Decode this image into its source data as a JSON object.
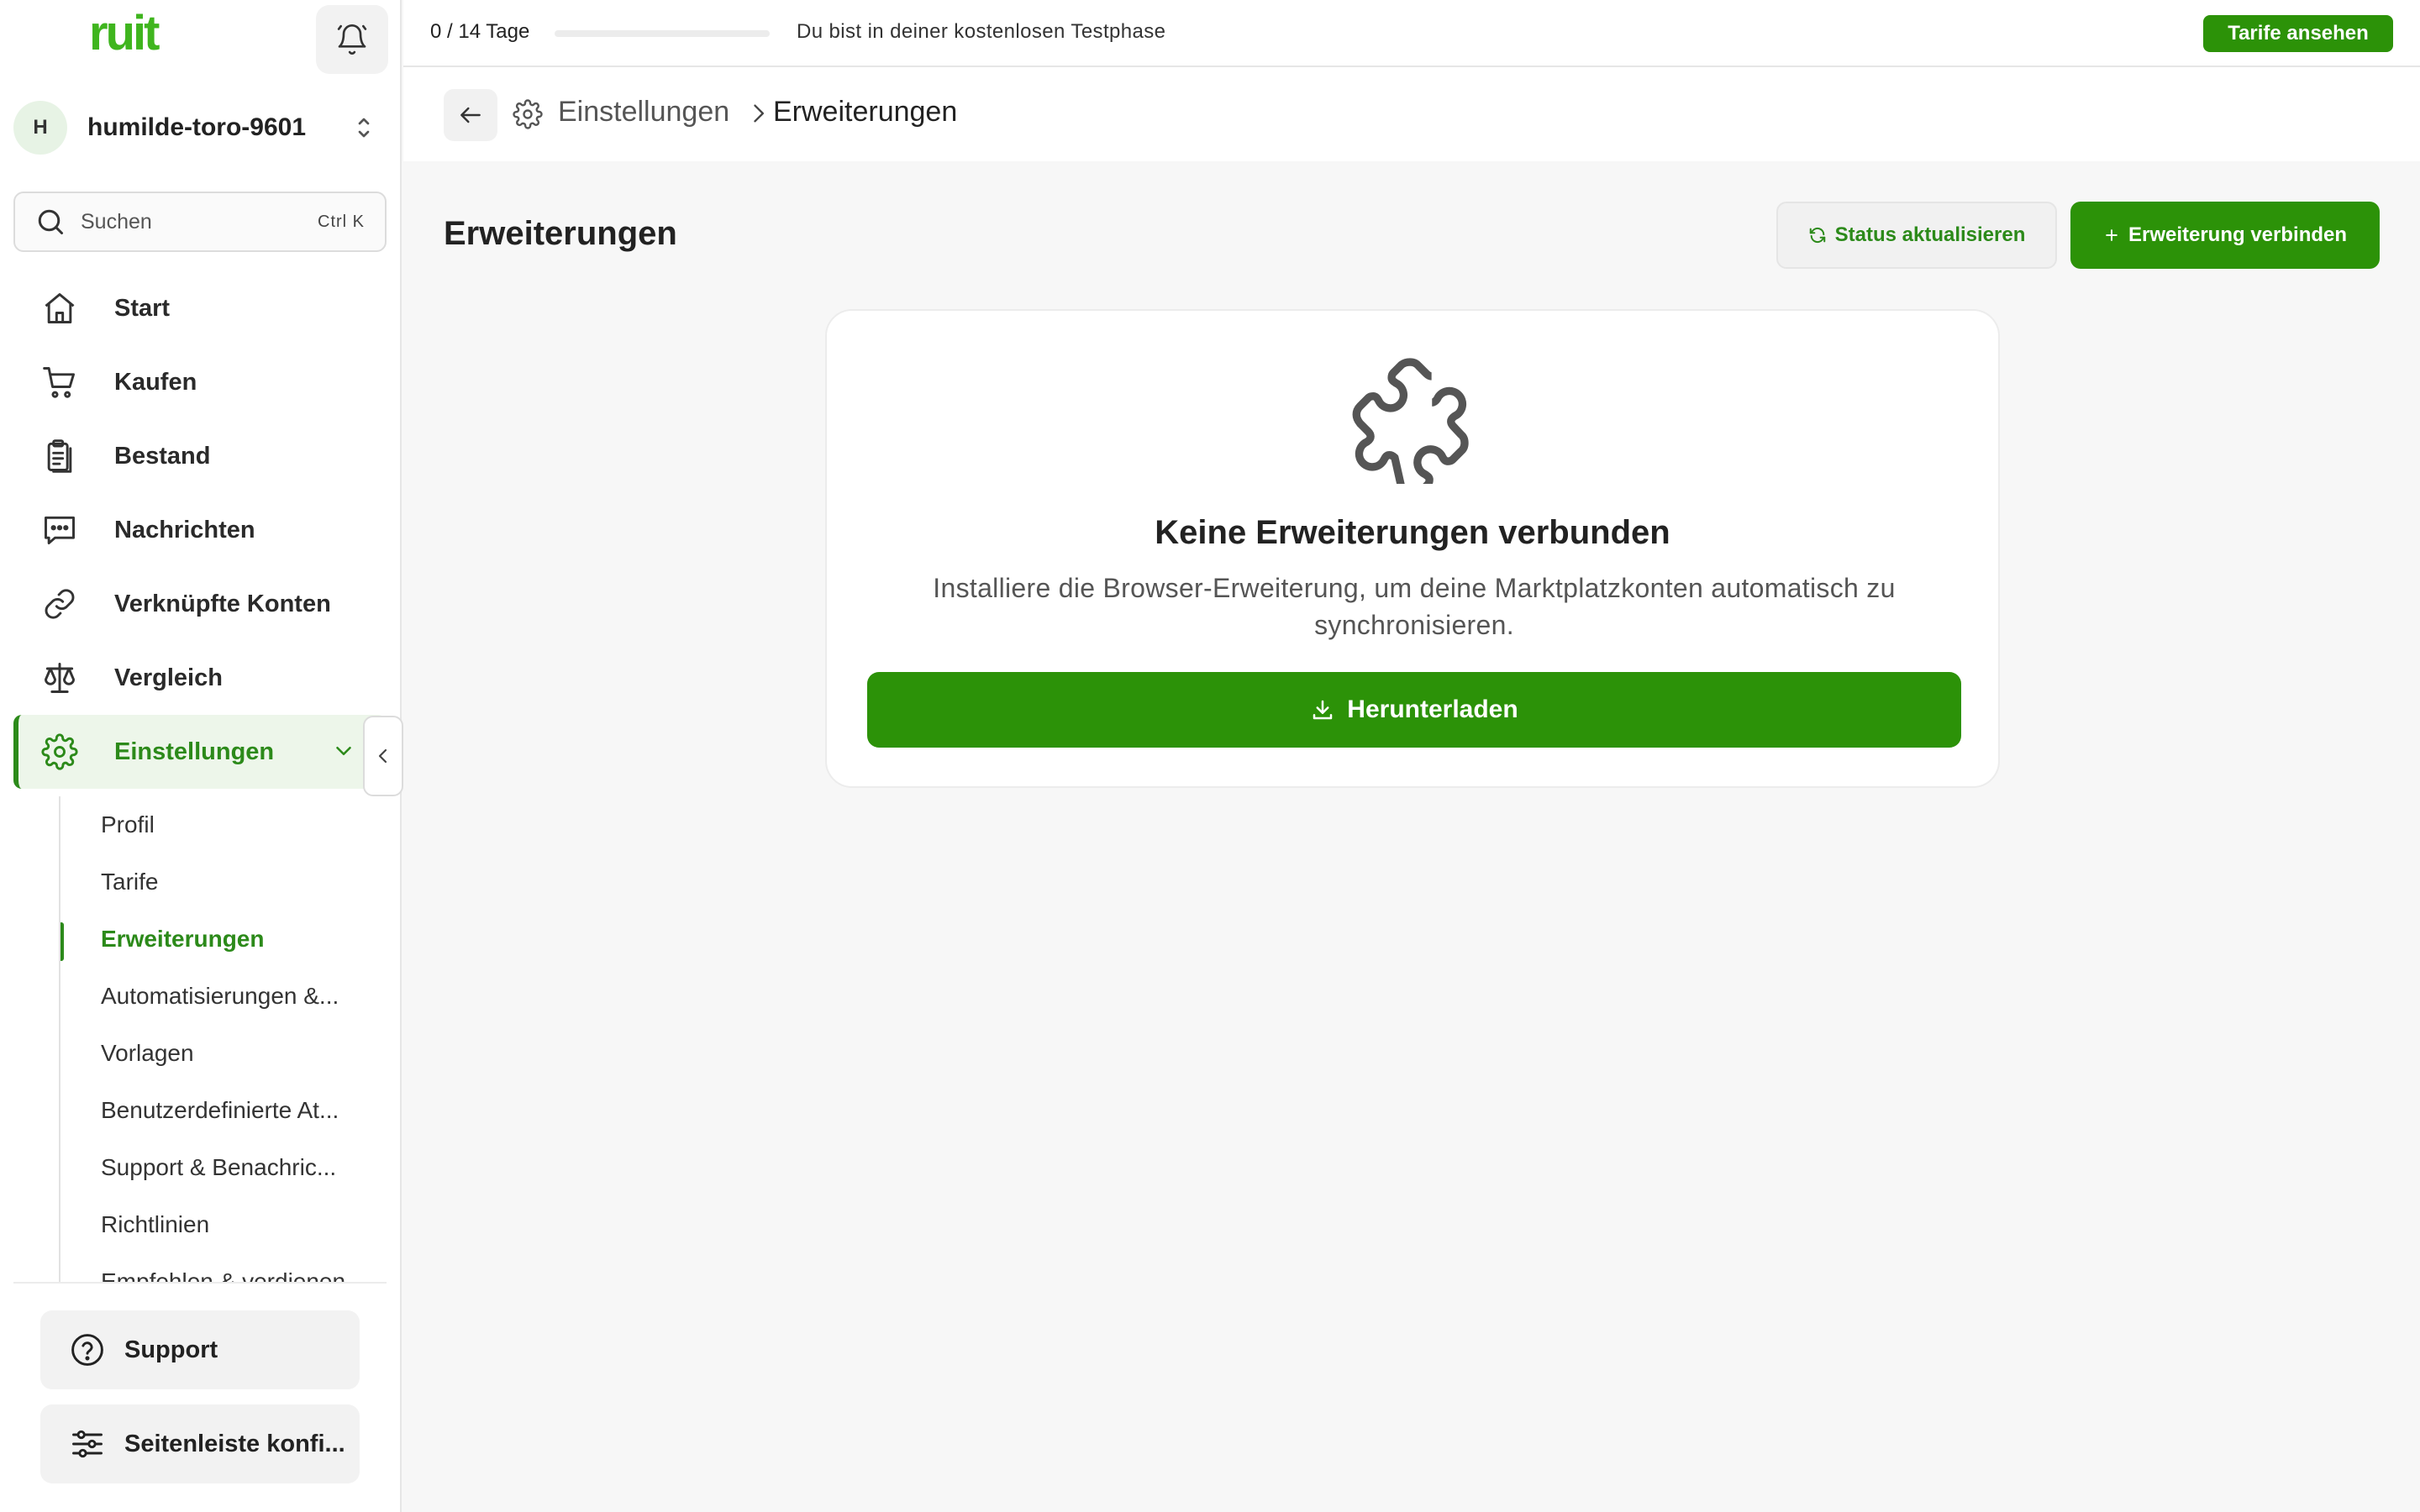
{
  "app": {
    "logo": "ruit"
  },
  "workspace": {
    "initial": "H",
    "name": "humilde-toro-9601"
  },
  "search": {
    "placeholder": "Suchen",
    "shortcut": "Ctrl K"
  },
  "nav": {
    "items": [
      {
        "label": "Start",
        "icon": "home-icon"
      },
      {
        "label": "Kaufen",
        "icon": "cart-icon"
      },
      {
        "label": "Bestand",
        "icon": "clipboard-icon"
      },
      {
        "label": "Nachrichten",
        "icon": "chat-icon"
      },
      {
        "label": "Verknüpfte Konten",
        "icon": "link-icon"
      },
      {
        "label": "Vergleich",
        "icon": "scale-icon"
      },
      {
        "label": "Einstellungen",
        "icon": "gear-icon",
        "active": true
      }
    ],
    "sub_items": [
      {
        "label": "Profil"
      },
      {
        "label": "Tarife"
      },
      {
        "label": "Erweiterungen",
        "active": true
      },
      {
        "label": "Automatisierungen &..."
      },
      {
        "label": "Vorlagen"
      },
      {
        "label": "Benutzerdefinierte At..."
      },
      {
        "label": "Support & Benachric..."
      },
      {
        "label": "Richtlinien"
      },
      {
        "label": "Empfehlen & verdienen"
      }
    ]
  },
  "footer": {
    "support": "Support",
    "customize": "Seitenleiste konfi..."
  },
  "topbar": {
    "trial_days": "0 / 14 Tage",
    "trial_progress": 0,
    "trial_text": "Du bist in deiner kostenlosen Testphase",
    "plans_button": "Tarife ansehen"
  },
  "breadcrumb": {
    "parent": "Einstellungen",
    "current": "Erweiterungen"
  },
  "main": {
    "title": "Erweiterungen",
    "refresh_button": "Status aktualisieren",
    "connect_button": "Erweiterung verbinden",
    "empty_title": "Keine Erweiterungen verbunden",
    "empty_desc": "Installiere die Browser-Erweiterung, um deine Marktplatzkonten automatisch zu synchronisieren.",
    "download_button": "Herunterladen"
  },
  "colors": {
    "brand": "#2c9208",
    "logo": "#3fb51e",
    "active_text": "#2c8a1a",
    "active_bg": "#edf6ea"
  }
}
